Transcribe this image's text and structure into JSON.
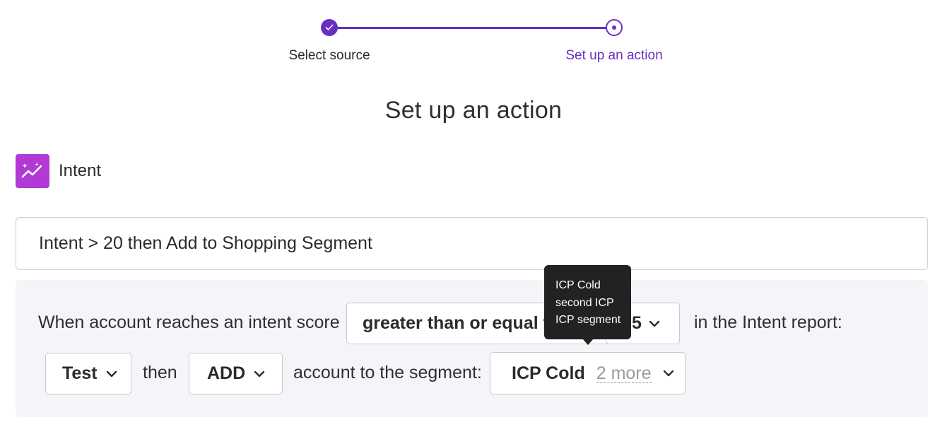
{
  "stepper": {
    "steps": [
      {
        "label": "Select source",
        "state": "done"
      },
      {
        "label": "Set up an action",
        "state": "active"
      }
    ]
  },
  "page_title": "Set up an action",
  "source": {
    "label": "Intent",
    "icon": "sparkle-trend-icon",
    "color": "#b13ad6"
  },
  "action_name": {
    "value": "Intent > 20 then Add to Shopping Segment"
  },
  "rule": {
    "prefix": "When account reaches an intent score",
    "operator": "greater than or equal to",
    "score": "5",
    "suffix": "in the Intent report:",
    "list": "Test",
    "then_text": "then",
    "action": "ADD",
    "segment_text": "account to the segment:",
    "segment_selected": "ICP Cold",
    "segment_more": "2 more"
  },
  "tooltip": {
    "items": [
      "ICP Cold",
      "second ICP",
      "ICP segment"
    ]
  },
  "colors": {
    "accent": "#6a2fc2",
    "intent_icon": "#b13ad6",
    "panel_bg": "#f3f5f9",
    "tooltip_bg": "#222222"
  }
}
